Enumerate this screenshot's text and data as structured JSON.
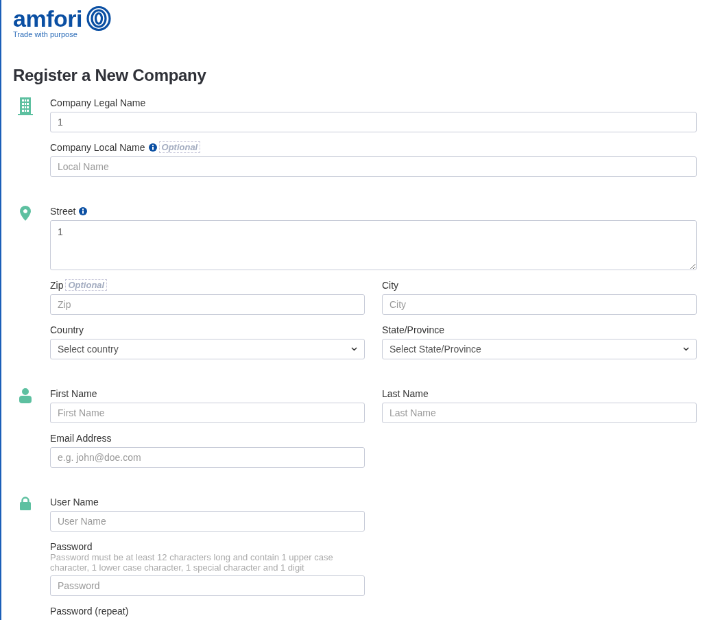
{
  "logo": {
    "wordmark": "amfori",
    "tagline": "Trade with purpose"
  },
  "heading": "Register a New Company",
  "sections": [
    {
      "rows": [
        [
          {
            "label": "Company Legal Name",
            "kind": "input",
            "value": "1"
          }
        ],
        [
          {
            "label": "Company Local Name",
            "info": true,
            "optional": "Optional",
            "kind": "input",
            "placeholder": "Local Name"
          }
        ]
      ]
    },
    {
      "rows": [
        [
          {
            "label": "Street",
            "info": true,
            "kind": "textarea",
            "value": "1"
          }
        ],
        [
          {
            "label": "Zip",
            "optional": "Optional",
            "kind": "input",
            "placeholder": "Zip"
          },
          {
            "label": "City",
            "kind": "input",
            "placeholder": "City"
          }
        ],
        [
          {
            "label": "Country",
            "kind": "select",
            "placeholder": "Select country"
          },
          {
            "label": "State/Province",
            "kind": "select",
            "placeholder": "Select State/Province"
          }
        ]
      ]
    },
    {
      "rows": [
        [
          {
            "label": "First Name",
            "kind": "input",
            "placeholder": "First Name"
          },
          {
            "label": "Last Name",
            "kind": "input",
            "placeholder": "Last Name"
          }
        ],
        [
          {
            "label": "Email Address",
            "kind": "input",
            "placeholder": "e.g. john@doe.com"
          }
        ]
      ]
    },
    {
      "rows": [
        [
          {
            "label": "User Name",
            "kind": "input",
            "placeholder": "User Name"
          }
        ],
        [
          {
            "label": "Password",
            "hint": "Password must be at least 12 characters long and contain 1 upper case character, 1 lower case character, 1 special character and 1 digit",
            "kind": "input",
            "placeholder": "Password"
          }
        ],
        [
          {
            "label": "Password (repeat)",
            "kind": "label"
          }
        ]
      ]
    }
  ]
}
